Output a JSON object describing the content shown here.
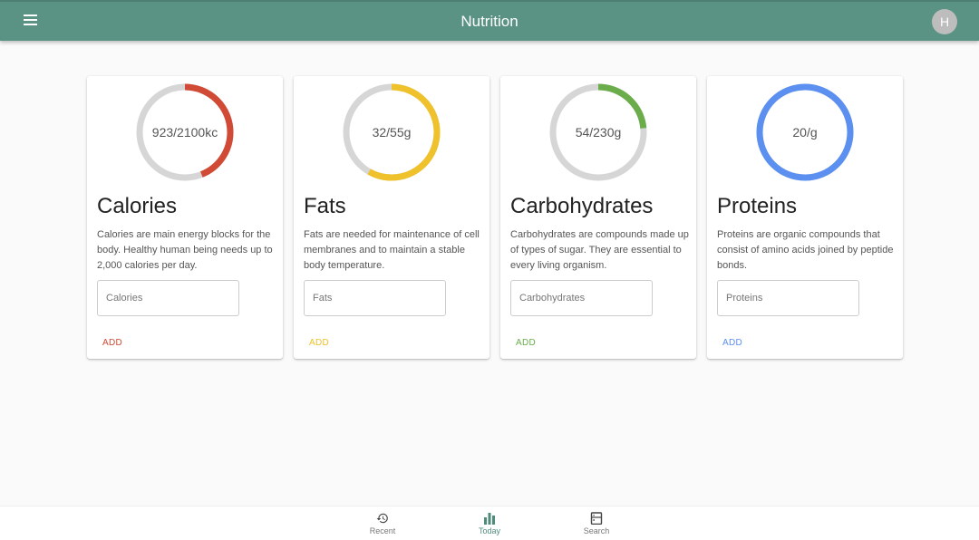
{
  "app": {
    "title": "Nutrition",
    "avatar_initial": "H"
  },
  "cards": [
    {
      "title": "Calories",
      "ring_label": "923/2100kc",
      "current": 923,
      "goal": 2100,
      "color": "#d04a35",
      "description": "Calories are main energy blocks for the body. Healthy human being needs up to 2,000 calories per day.",
      "placeholder": "Calories",
      "add_label": "ADD"
    },
    {
      "title": "Fats",
      "ring_label": "32/55g",
      "current": 32,
      "goal": 55,
      "color": "#efc12a",
      "description": "Fats are needed for maintenance of cell membranes and to maintain a stable body temperature.",
      "placeholder": "Fats",
      "add_label": "ADD"
    },
    {
      "title": "Carbohydrates",
      "ring_label": "54/230g",
      "current": 54,
      "goal": 230,
      "color": "#6aad4a",
      "description": "Carbohydrates are compounds made up of types of sugar. They are essential to every living organism.",
      "placeholder": "Carbohydrates",
      "add_label": "ADD"
    },
    {
      "title": "Proteins",
      "ring_label": "20/g",
      "current": 20,
      "goal": 20,
      "color": "#5b8ff0",
      "description": "Proteins are organic compounds that consist of amino acids joined by peptide bonds.",
      "placeholder": "Proteins",
      "add_label": "ADD"
    }
  ],
  "bottom_nav": [
    {
      "label": "Recent",
      "icon": "history-icon",
      "active": false
    },
    {
      "label": "Today",
      "icon": "bar-chart-icon",
      "active": true
    },
    {
      "label": "Search",
      "icon": "search-icon",
      "active": false
    }
  ],
  "accent": "#4f8b7b"
}
